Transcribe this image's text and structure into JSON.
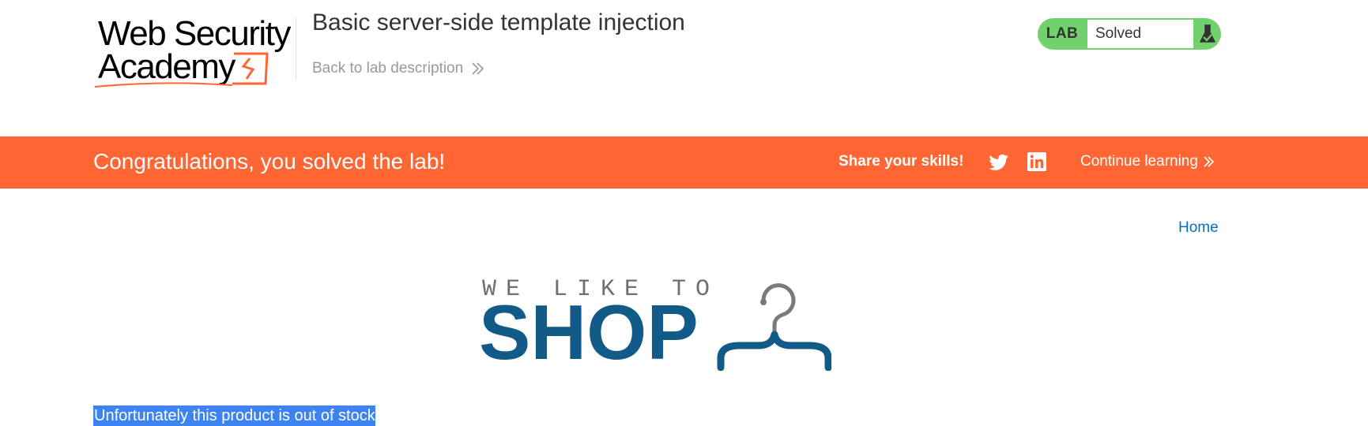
{
  "header": {
    "logo": {
      "line1": "Web Security",
      "line2": "Academy",
      "accent_color": "#ff6633"
    },
    "lab_title": "Basic server-side template injection",
    "back_link_label": "Back to lab description",
    "status": {
      "tag": "LAB",
      "value": "Solved",
      "icon": "flask-check-icon",
      "color": "#70d16d"
    }
  },
  "banner": {
    "message": "Congratulations, you solved the lab!",
    "share_label": "Share your skills!",
    "share_icons": [
      "twitter-icon",
      "linkedin-icon"
    ],
    "continue_label": "Continue learning",
    "color": "#ff6633"
  },
  "nav": {
    "home_label": "Home"
  },
  "shop_logo": {
    "tagline": "WE LIKE TO",
    "word": "SHOP",
    "icon": "hanger-icon",
    "color": "#125a87"
  },
  "main": {
    "stock_message": "Unfortunately this product is out of stock"
  }
}
